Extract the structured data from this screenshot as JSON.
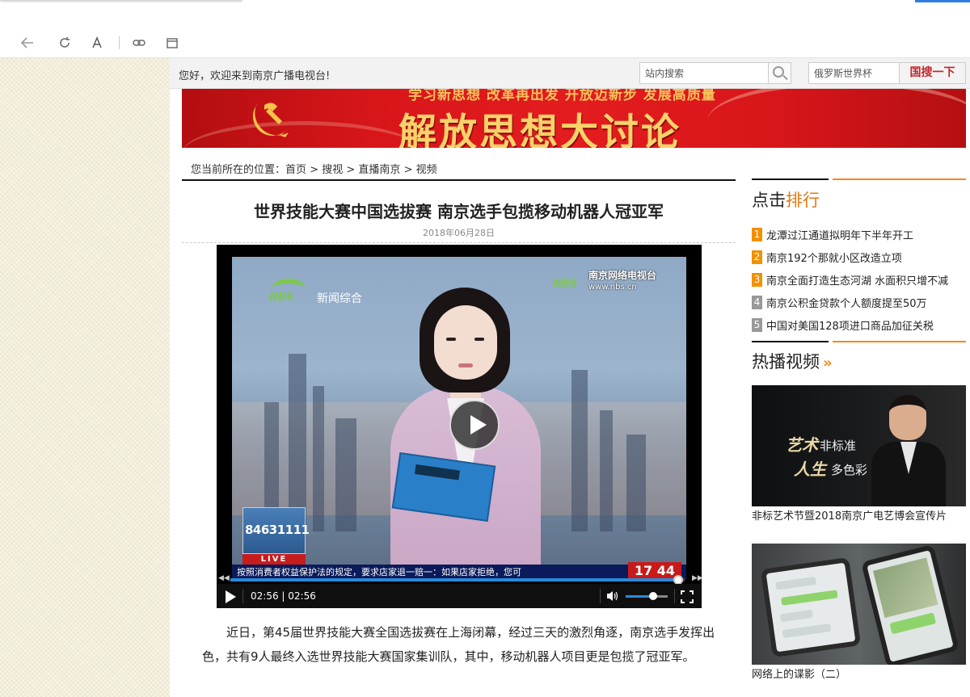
{
  "browser": {
    "back_icon": "arrow-left-icon",
    "reload_icon": "reload-icon",
    "font_icon": "font-size-icon",
    "link_icon": "link-icon",
    "window_icon": "window-icon"
  },
  "topbar": {
    "welcome": "您好，欢迎来到南京广播电视台!",
    "site_search_value": "站内搜索",
    "guosou_value": "俄罗斯世界杯",
    "guosou_button": "国搜一下"
  },
  "banner": {
    "subtitle": "学习新思想 改革再出发 开放迈新步 发展高质量",
    "title": "解放思想大讨论"
  },
  "breadcrumb": {
    "prefix": "您当前所在的位置：",
    "items": [
      "首页",
      "搜视",
      "直播南京",
      "视频"
    ],
    "separator": ">"
  },
  "article": {
    "title": "世界技能大赛中国选拔赛 南京选手包揽移动机器人冠亚军",
    "date": "2018年06月28日",
    "body": "近日，第45届世界技能大赛全国选拔赛在上海闭幕，经过三天的激烈角逐，南京选手发挥出色，共有9人最终入选世界技能大赛国家集训队，其中，移动机器人项目更是包揽了冠亚军。"
  },
  "video": {
    "channel_brand": "NBS",
    "channel_name": "新闻综合",
    "watermark_brand": "NBS",
    "watermark_title": "南京网络电视台",
    "watermark_url": "www.nbs.cn",
    "hotline": "84631111",
    "live_label": "LIVE",
    "ticker": "按照消费者权益保护法的规定，要求店家退一赔一：如果店家拒绝，您可",
    "ticker_time": "17 44",
    "time_display": "02:56 | 02:56",
    "progress": 0.99,
    "volume": 0.65
  },
  "sidebar": {
    "ranking_title_a": "点击",
    "ranking_title_b": "排行",
    "ranking": [
      {
        "rank": "1",
        "title": "龙潭过江通道拟明年下半年开工"
      },
      {
        "rank": "2",
        "title": "南京192个那就小区改造立项"
      },
      {
        "rank": "3",
        "title": "南京全面打造生态河湖 水面积只增不减"
      },
      {
        "rank": "4",
        "title": "南京公积金贷款个人额度提至50万"
      },
      {
        "rank": "5",
        "title": "中国对美国128项进口商品加征关税"
      }
    ],
    "hot_title": "热播视频",
    "hot_arrow": "»",
    "videos": [
      {
        "caption": "非标艺术节暨2018南京广电艺博会宣传片",
        "thumb_text_a": "艺术",
        "thumb_text_b": "非标准",
        "thumb_text_c": "人生",
        "thumb_text_d": "多色彩"
      },
      {
        "caption": "网络上的谍影（二）"
      }
    ]
  },
  "colors": {
    "accent_orange": "#f08a1c",
    "banner_red": "#d8161a",
    "guosou_red": "#c0262c",
    "progress_blue": "#2a8bd8"
  }
}
